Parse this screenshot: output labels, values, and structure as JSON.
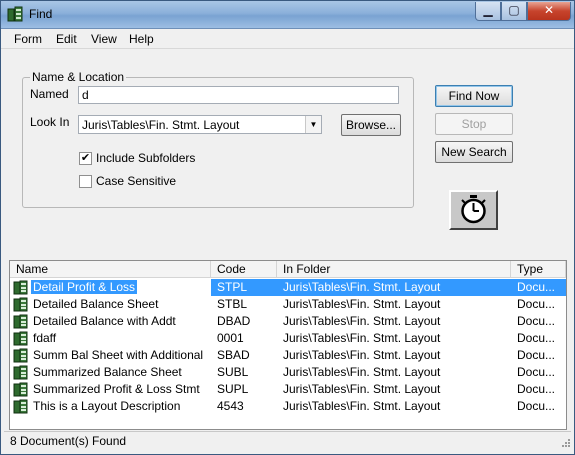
{
  "window": {
    "title": "Find"
  },
  "menu": [
    "Form",
    "Edit",
    "View",
    "Help"
  ],
  "group": {
    "legend": "Name & Location"
  },
  "named": {
    "label": "Named",
    "value": "d"
  },
  "look_in": {
    "label": "Look In",
    "value": "Juris\\Tables\\Fin. Stmt. Layout"
  },
  "browse_label": "Browse...",
  "include_subfolders": {
    "label": "Include Subfolders",
    "checked": true
  },
  "case_sensitive": {
    "label": "Case Sensitive",
    "checked": false
  },
  "buttons": {
    "find_now": "Find Now",
    "stop": "Stop",
    "new_search": "New Search"
  },
  "columns": [
    "Name",
    "Code",
    "In Folder",
    "Type"
  ],
  "rows": [
    {
      "name": "Detail Profit & Loss",
      "code": "STPL",
      "folder": "Juris\\Tables\\Fin. Stmt. Layout",
      "type": "Docu...",
      "selected": true
    },
    {
      "name": "Detailed Balance Sheet",
      "code": "STBL",
      "folder": "Juris\\Tables\\Fin. Stmt. Layout",
      "type": "Docu..."
    },
    {
      "name": "Detailed Balance with Addt",
      "code": "DBAD",
      "folder": "Juris\\Tables\\Fin. Stmt. Layout",
      "type": "Docu..."
    },
    {
      "name": "fdaff",
      "code": "0001",
      "folder": "Juris\\Tables\\Fin. Stmt. Layout",
      "type": "Docu..."
    },
    {
      "name": "Summ Bal Sheet with Additional",
      "code": "SBAD",
      "folder": "Juris\\Tables\\Fin. Stmt. Layout",
      "type": "Docu..."
    },
    {
      "name": "Summarized Balance Sheet",
      "code": "SUBL",
      "folder": "Juris\\Tables\\Fin. Stmt. Layout",
      "type": "Docu..."
    },
    {
      "name": "Summarized Profit & Loss Stmt",
      "code": "SUPL",
      "folder": "Juris\\Tables\\Fin. Stmt. Layout",
      "type": "Docu..."
    },
    {
      "name": "This is a Layout Description",
      "code": "4543",
      "folder": "Juris\\Tables\\Fin. Stmt. Layout",
      "type": "Docu..."
    }
  ],
  "status": "8 Document(s) Found",
  "icons": {
    "app": "cabinet-icon",
    "document": "document-cabinet-icon",
    "stopwatch": "stopwatch-icon"
  }
}
